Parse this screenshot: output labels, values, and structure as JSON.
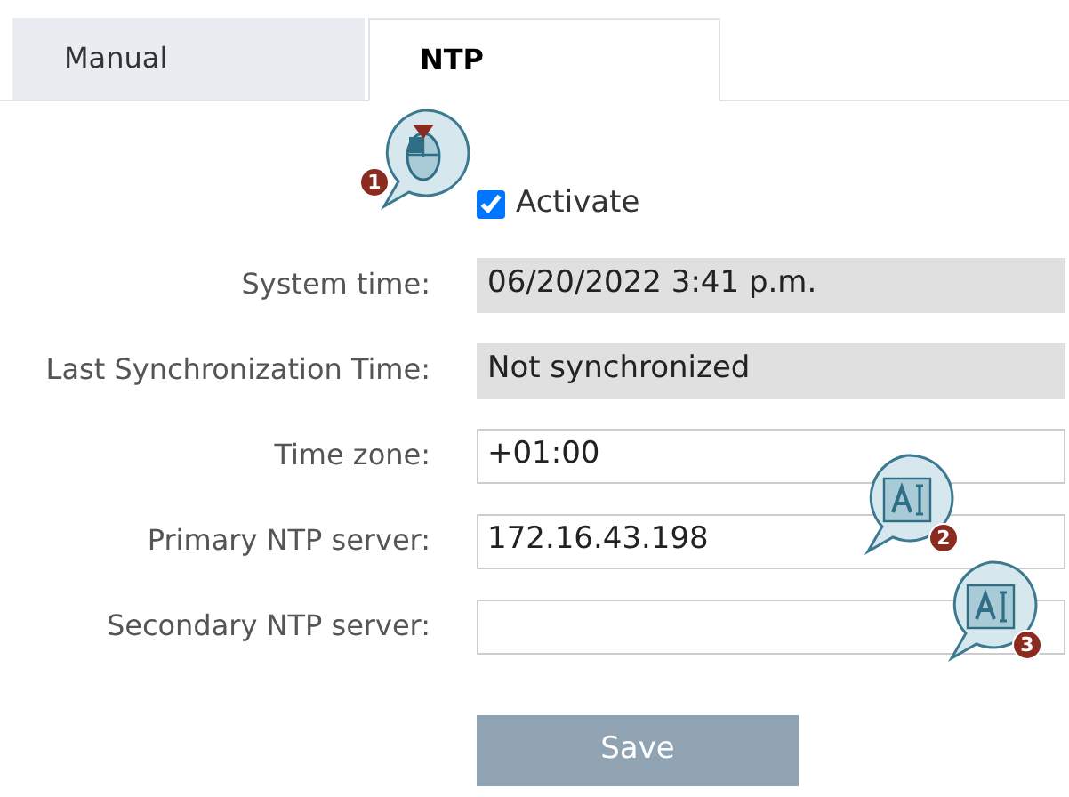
{
  "tabs": [
    {
      "label": "Manual",
      "selected": false
    },
    {
      "label": "NTP",
      "selected": true
    }
  ],
  "activate": {
    "label": "Activate",
    "checked": true
  },
  "fields": [
    {
      "label": "System time:",
      "value": "06/20/2022 3:41 p.m.",
      "kind": "readonly"
    },
    {
      "label": "Last Synchronization Time:",
      "value": "Not synchronized",
      "kind": "readonly"
    },
    {
      "label": "Time zone:",
      "value": "+01:00",
      "kind": "input"
    },
    {
      "label": "Primary NTP server:",
      "value": "172.16.43.198",
      "kind": "input"
    },
    {
      "label": "Secondary NTP server:",
      "kind": "input"
    }
  ],
  "callouts": [
    {
      "number": "1",
      "kind": "mouse"
    },
    {
      "number": "2",
      "kind": "text-input"
    },
    {
      "number": "3",
      "kind": "text-input"
    }
  ],
  "save_button": {
    "label": "Save"
  }
}
